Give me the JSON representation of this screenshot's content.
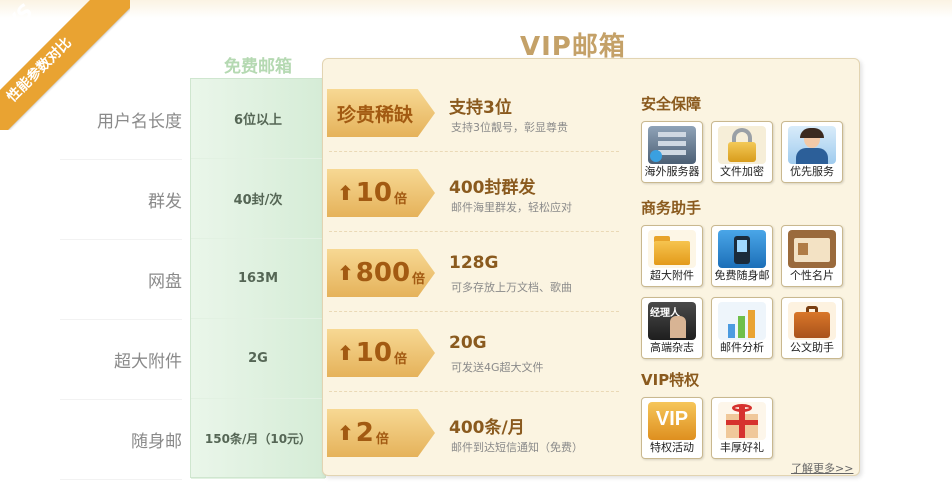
{
  "corner": {
    "vs": "VS",
    "title": "性能参数对比"
  },
  "headings": {
    "free": "免费邮箱",
    "vip": "VIP邮箱"
  },
  "rows": [
    {
      "label": "用户名长度",
      "free": "6位以上",
      "badge_word": "珍贵稀缺",
      "vip_title": "支持3位",
      "vip_desc": "支持3位靓号，彰显尊贵"
    },
    {
      "label": "群发",
      "free": "40封/次",
      "badge_num": "10",
      "badge_unit": "倍",
      "vip_title": "400封群发",
      "vip_desc": "邮件海里群发，轻松应对"
    },
    {
      "label": "网盘",
      "free": "163M",
      "badge_num": "800",
      "badge_unit": "倍",
      "vip_title": "128G",
      "vip_desc": "可多存放上万文档、歌曲"
    },
    {
      "label": "超大附件",
      "free": "2G",
      "badge_num": "10",
      "badge_unit": "倍",
      "vip_title": "20G",
      "vip_desc": "可发送4G超大文件"
    },
    {
      "label": "随身邮",
      "free": "150条/月（10元）",
      "badge_num": "2",
      "badge_unit": "倍",
      "vip_title": "400条/月",
      "vip_desc": "邮件到达短信通知（免费）"
    }
  ],
  "sections": {
    "security": {
      "title": "安全保障",
      "items": [
        "海外服务器",
        "文件加密",
        "优先服务"
      ]
    },
    "business": {
      "title": "商务助手",
      "items": [
        "超大附件",
        "免费随身邮",
        "个性名片",
        "高端杂志",
        "邮件分析",
        "公文助手"
      ]
    },
    "vip": {
      "title": "VIP特权",
      "items": [
        "特权活动",
        "丰厚好礼"
      ]
    }
  },
  "icons": [
    "server-icon",
    "lock-icon",
    "support-agent-icon",
    "folder-icon",
    "phone-mail-icon",
    "business-card-icon",
    "magazine-icon",
    "chart-icon",
    "briefcase-icon",
    "vip-badge-icon",
    "gift-icon"
  ],
  "more_link": "了解更多>>",
  "colors": {
    "accent": "#e9a332",
    "free_bg": "#d5ecd6",
    "vip_bg": "#fbf4e1",
    "title_brown": "#8a5a1e"
  }
}
